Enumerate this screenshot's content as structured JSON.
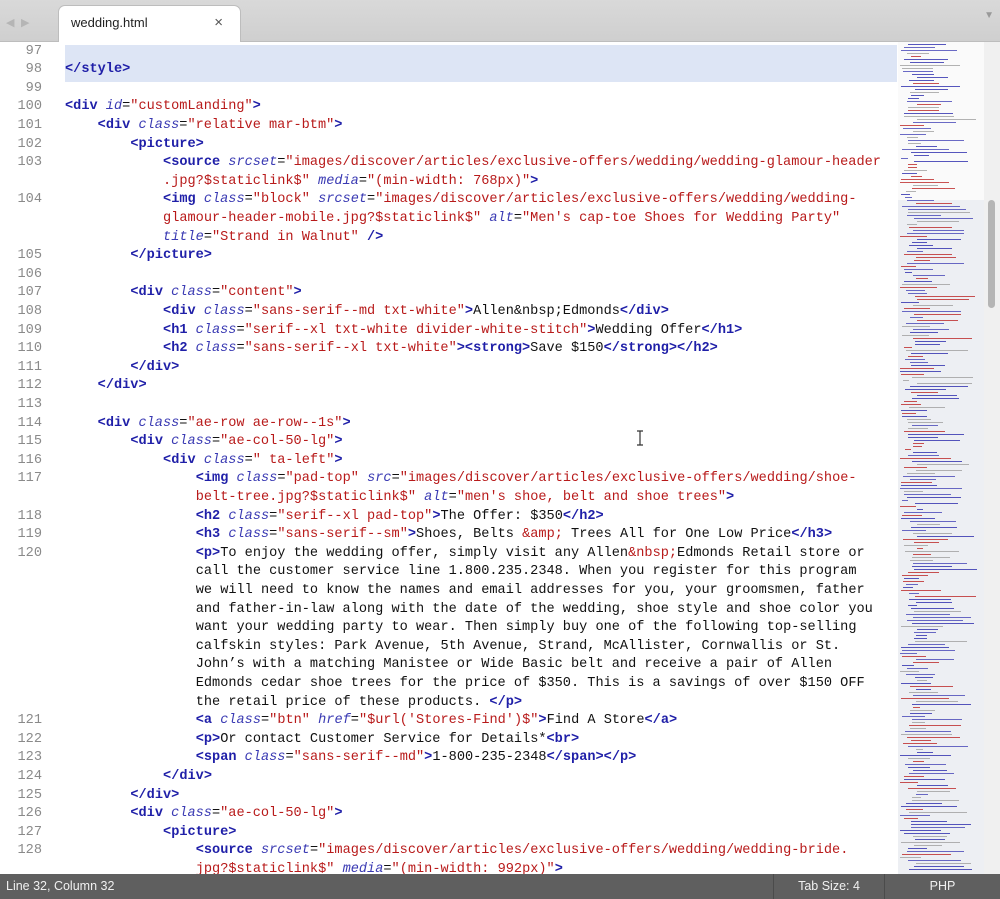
{
  "tab": {
    "filename": "wedding.html",
    "close_glyph": "×"
  },
  "nav": {
    "back_glyph": "◀",
    "forward_glyph": "▶",
    "menu_glyph": "▼"
  },
  "status": {
    "position": "Line 32, Column 32",
    "tab_size": "Tab Size: 4",
    "syntax": "PHP"
  },
  "colors": {
    "tag": "#1f1fa8",
    "attribute": "#3a3ab3",
    "string": "#b81a1a",
    "text": "#111111",
    "line_highlight": "#dde5f5",
    "statusbar": "#5f5f5f"
  },
  "gutter_lines": [
    {
      "n": "97",
      "row": 0
    },
    {
      "n": "98",
      "row": 1
    },
    {
      "n": "99",
      "row": 2
    },
    {
      "n": "100",
      "row": 3
    },
    {
      "n": "101",
      "row": 4
    },
    {
      "n": "102",
      "row": 5
    },
    {
      "n": "103",
      "row": 6
    },
    {
      "n": "104",
      "row": 8
    },
    {
      "n": "105",
      "row": 11
    },
    {
      "n": "106",
      "row": 12
    },
    {
      "n": "107",
      "row": 13
    },
    {
      "n": "108",
      "row": 14
    },
    {
      "n": "109",
      "row": 15
    },
    {
      "n": "110",
      "row": 16
    },
    {
      "n": "111",
      "row": 17
    },
    {
      "n": "112",
      "row": 18
    },
    {
      "n": "113",
      "row": 19
    },
    {
      "n": "114",
      "row": 20
    },
    {
      "n": "115",
      "row": 21
    },
    {
      "n": "116",
      "row": 22
    },
    {
      "n": "117",
      "row": 23
    },
    {
      "n": "118",
      "row": 25
    },
    {
      "n": "119",
      "row": 26
    },
    {
      "n": "120",
      "row": 27
    },
    {
      "n": "121",
      "row": 36
    },
    {
      "n": "122",
      "row": 37
    },
    {
      "n": "123",
      "row": 38
    },
    {
      "n": "124",
      "row": 39
    },
    {
      "n": "125",
      "row": 40
    },
    {
      "n": "126",
      "row": 41
    },
    {
      "n": "127",
      "row": 42
    },
    {
      "n": "128",
      "row": 43
    }
  ],
  "code_rows": [
    {
      "indent": 0,
      "tokens": []
    },
    {
      "indent": 0,
      "tokens": [
        [
          "t",
          "</style>"
        ]
      ]
    },
    {
      "indent": 0,
      "tokens": []
    },
    {
      "indent": 0,
      "tokens": [
        [
          "t",
          "<div "
        ],
        [
          "a",
          "id"
        ],
        [
          "x",
          "="
        ],
        [
          "s",
          "\"customLanding\""
        ],
        [
          "t",
          ">"
        ]
      ]
    },
    {
      "indent": 4,
      "tokens": [
        [
          "t",
          "<div "
        ],
        [
          "a",
          "class"
        ],
        [
          "x",
          "="
        ],
        [
          "s",
          "\"relative mar-btm\""
        ],
        [
          "t",
          ">"
        ]
      ]
    },
    {
      "indent": 8,
      "tokens": [
        [
          "t",
          "<picture>"
        ]
      ]
    },
    {
      "indent": 12,
      "tokens": [
        [
          "t",
          "<source "
        ],
        [
          "a",
          "srcset"
        ],
        [
          "x",
          "="
        ],
        [
          "s",
          "\"images/discover/articles/exclusive-offers/wedding/wedding-glamour-header"
        ]
      ]
    },
    {
      "indent": 12,
      "tokens": [
        [
          "s",
          ".jpg?$staticlink$\""
        ],
        [
          "x",
          " "
        ],
        [
          "a",
          "media"
        ],
        [
          "x",
          "="
        ],
        [
          "s",
          "\"(min-width: 768px)\""
        ],
        [
          "t",
          ">"
        ]
      ]
    },
    {
      "indent": 12,
      "tokens": [
        [
          "t",
          "<img "
        ],
        [
          "a",
          "class"
        ],
        [
          "x",
          "="
        ],
        [
          "s",
          "\"block\""
        ],
        [
          "x",
          " "
        ],
        [
          "a",
          "srcset"
        ],
        [
          "x",
          "="
        ],
        [
          "s",
          "\"images/discover/articles/exclusive-offers/wedding/wedding-"
        ]
      ]
    },
    {
      "indent": 12,
      "tokens": [
        [
          "s",
          "glamour-header-mobile.jpg?$staticlink$\""
        ],
        [
          "x",
          " "
        ],
        [
          "a",
          "alt"
        ],
        [
          "x",
          "="
        ],
        [
          "s",
          "\"Men's cap-toe Shoes for Wedding Party\""
        ]
      ]
    },
    {
      "indent": 12,
      "tokens": [
        [
          "a",
          "title"
        ],
        [
          "x",
          "="
        ],
        [
          "s",
          "\"Strand in Walnut\""
        ],
        [
          "x",
          " "
        ],
        [
          "t",
          "/>"
        ]
      ]
    },
    {
      "indent": 8,
      "tokens": [
        [
          "t",
          "</picture>"
        ]
      ]
    },
    {
      "indent": 0,
      "tokens": []
    },
    {
      "indent": 8,
      "tokens": [
        [
          "t",
          "<div "
        ],
        [
          "a",
          "class"
        ],
        [
          "x",
          "="
        ],
        [
          "s",
          "\"content\""
        ],
        [
          "t",
          ">"
        ]
      ]
    },
    {
      "indent": 12,
      "tokens": [
        [
          "t",
          "<div "
        ],
        [
          "a",
          "class"
        ],
        [
          "x",
          "="
        ],
        [
          "s",
          "\"sans-serif--md txt-white\""
        ],
        [
          "t",
          ">"
        ],
        [
          "x",
          "Allen&nbsp;Edmonds"
        ],
        [
          "t",
          "</div>"
        ]
      ]
    },
    {
      "indent": 12,
      "tokens": [
        [
          "t",
          "<h1 "
        ],
        [
          "a",
          "class"
        ],
        [
          "x",
          "="
        ],
        [
          "s",
          "\"serif--xl txt-white divider-white-stitch\""
        ],
        [
          "t",
          ">"
        ],
        [
          "x",
          "Wedding Offer"
        ],
        [
          "t",
          "</h1>"
        ]
      ]
    },
    {
      "indent": 12,
      "tokens": [
        [
          "t",
          "<h2 "
        ],
        [
          "a",
          "class"
        ],
        [
          "x",
          "="
        ],
        [
          "s",
          "\"sans-serif--xl txt-white\""
        ],
        [
          "t",
          "><strong>"
        ],
        [
          "x",
          "Save $150"
        ],
        [
          "t",
          "</strong></h2>"
        ]
      ]
    },
    {
      "indent": 8,
      "tokens": [
        [
          "t",
          "</div>"
        ]
      ]
    },
    {
      "indent": 4,
      "tokens": [
        [
          "t",
          "</div>"
        ]
      ]
    },
    {
      "indent": 0,
      "tokens": []
    },
    {
      "indent": 4,
      "tokens": [
        [
          "t",
          "<div "
        ],
        [
          "a",
          "class"
        ],
        [
          "x",
          "="
        ],
        [
          "s",
          "\"ae-row ae-row--1s\""
        ],
        [
          "t",
          ">"
        ]
      ]
    },
    {
      "indent": 8,
      "tokens": [
        [
          "t",
          "<div "
        ],
        [
          "a",
          "class"
        ],
        [
          "x",
          "="
        ],
        [
          "s",
          "\"ae-col-50-lg\""
        ],
        [
          "t",
          ">"
        ]
      ]
    },
    {
      "indent": 12,
      "tokens": [
        [
          "t",
          "<div "
        ],
        [
          "a",
          "class"
        ],
        [
          "x",
          "="
        ],
        [
          "s",
          "\" ta-left\""
        ],
        [
          "t",
          ">"
        ]
      ]
    },
    {
      "indent": 16,
      "tokens": [
        [
          "t",
          "<img "
        ],
        [
          "a",
          "class"
        ],
        [
          "x",
          "="
        ],
        [
          "s",
          "\"pad-top\""
        ],
        [
          "x",
          " "
        ],
        [
          "a",
          "src"
        ],
        [
          "x",
          "="
        ],
        [
          "s",
          "\"images/discover/articles/exclusive-offers/wedding/shoe-"
        ]
      ]
    },
    {
      "indent": 16,
      "tokens": [
        [
          "s",
          "belt-tree.jpg?$staticlink$\""
        ],
        [
          "x",
          " "
        ],
        [
          "a",
          "alt"
        ],
        [
          "x",
          "="
        ],
        [
          "s",
          "\"men's shoe, belt and shoe trees\""
        ],
        [
          "t",
          ">"
        ]
      ]
    },
    {
      "indent": 16,
      "tokens": [
        [
          "t",
          "<h2 "
        ],
        [
          "a",
          "class"
        ],
        [
          "x",
          "="
        ],
        [
          "s",
          "\"serif--xl pad-top\""
        ],
        [
          "t",
          ">"
        ],
        [
          "x",
          "The Offer: $350"
        ],
        [
          "t",
          "</h2>"
        ]
      ]
    },
    {
      "indent": 16,
      "tokens": [
        [
          "t",
          "<h3 "
        ],
        [
          "a",
          "class"
        ],
        [
          "x",
          "="
        ],
        [
          "s",
          "\"sans-serif--sm\""
        ],
        [
          "t",
          ">"
        ],
        [
          "x",
          "Shoes, Belts "
        ],
        [
          "s",
          "&amp;"
        ],
        [
          "x",
          " Trees All for One Low Price"
        ],
        [
          "t",
          "</h3>"
        ]
      ]
    },
    {
      "indent": 16,
      "tokens": [
        [
          "t",
          "<p>"
        ],
        [
          "x",
          "To enjoy the wedding offer, simply visit any Allen"
        ],
        [
          "s",
          "&nbsp;"
        ],
        [
          "x",
          "Edmonds Retail store or"
        ]
      ]
    },
    {
      "indent": 16,
      "tokens": [
        [
          "x",
          "call the customer service line 1.800.235.2348. When you register for this program"
        ]
      ]
    },
    {
      "indent": 16,
      "tokens": [
        [
          "x",
          "we will need to know the names and email addresses for you, your groomsmen, father"
        ]
      ]
    },
    {
      "indent": 16,
      "tokens": [
        [
          "x",
          "and father-in-law along with the date of the wedding, shoe style and shoe color you"
        ]
      ]
    },
    {
      "indent": 16,
      "tokens": [
        [
          "x",
          "want your wedding party to wear. Then simply buy one of the following top-selling"
        ]
      ]
    },
    {
      "indent": 16,
      "tokens": [
        [
          "x",
          "calfskin styles: Park Avenue, 5th Avenue, Strand, McAllister, Cornwallis or St."
        ]
      ]
    },
    {
      "indent": 16,
      "tokens": [
        [
          "x",
          "John’s with a matching Manistee or Wide Basic belt and receive a pair of Allen"
        ]
      ]
    },
    {
      "indent": 16,
      "tokens": [
        [
          "x",
          "Edmonds cedar shoe trees for the price of $350. This is a savings of over $150 OFF"
        ]
      ]
    },
    {
      "indent": 16,
      "tokens": [
        [
          "x",
          "the retail price of these products. "
        ],
        [
          "t",
          "</p>"
        ]
      ]
    },
    {
      "indent": 16,
      "tokens": [
        [
          "t",
          "<a "
        ],
        [
          "a",
          "class"
        ],
        [
          "x",
          "="
        ],
        [
          "s",
          "\"btn\""
        ],
        [
          "x",
          " "
        ],
        [
          "a",
          "href"
        ],
        [
          "x",
          "="
        ],
        [
          "s",
          "\"$url('Stores-Find')$\""
        ],
        [
          "t",
          ">"
        ],
        [
          "x",
          "Find A Store"
        ],
        [
          "t",
          "</a>"
        ]
      ]
    },
    {
      "indent": 16,
      "tokens": [
        [
          "t",
          "<p>"
        ],
        [
          "x",
          "Or contact Customer Service for Details*"
        ],
        [
          "t",
          "<br>"
        ]
      ]
    },
    {
      "indent": 16,
      "tokens": [
        [
          "t",
          "<span "
        ],
        [
          "a",
          "class"
        ],
        [
          "x",
          "="
        ],
        [
          "s",
          "\"sans-serif--md\""
        ],
        [
          "t",
          ">"
        ],
        [
          "x",
          "1-800-235-2348"
        ],
        [
          "t",
          "</span></p>"
        ]
      ]
    },
    {
      "indent": 12,
      "tokens": [
        [
          "t",
          "</div>"
        ]
      ]
    },
    {
      "indent": 8,
      "tokens": [
        [
          "t",
          "</div>"
        ]
      ]
    },
    {
      "indent": 8,
      "tokens": [
        [
          "t",
          "<div "
        ],
        [
          "a",
          "class"
        ],
        [
          "x",
          "="
        ],
        [
          "s",
          "\"ae-col-50-lg\""
        ],
        [
          "t",
          ">"
        ]
      ]
    },
    {
      "indent": 12,
      "tokens": [
        [
          "t",
          "<picture>"
        ]
      ]
    },
    {
      "indent": 16,
      "tokens": [
        [
          "t",
          "<source "
        ],
        [
          "a",
          "srcset"
        ],
        [
          "x",
          "="
        ],
        [
          "s",
          "\"images/discover/articles/exclusive-offers/wedding/wedding-bride."
        ]
      ]
    },
    {
      "indent": 16,
      "tokens": [
        [
          "s",
          "jpg?$staticlink$\""
        ],
        [
          "x",
          " "
        ],
        [
          "a",
          "media"
        ],
        [
          "x",
          "="
        ],
        [
          "s",
          "\"(min-width: 992px)\""
        ],
        [
          "t",
          ">"
        ]
      ]
    }
  ]
}
